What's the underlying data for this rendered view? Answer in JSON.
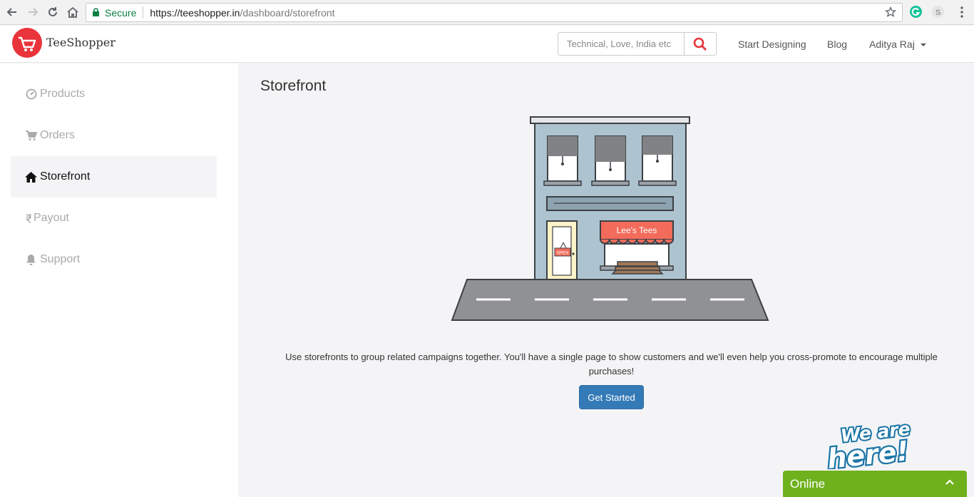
{
  "browser": {
    "secure_label": "Secure",
    "url_host": "https://teeshopper.in",
    "url_path": "/dashboard/storefront",
    "icons": [
      "back-icon",
      "forward-icon",
      "reload-icon",
      "home-icon",
      "lock-icon",
      "star-icon",
      "grammarly-icon",
      "skype-icon",
      "menu-icon"
    ]
  },
  "header": {
    "brand": "TeeShopper",
    "search_placeholder": "Technical, Love, India etc",
    "nav": {
      "start_designing": "Start Designing",
      "blog": "Blog",
      "user": "Aditya Raj"
    }
  },
  "sidebar": {
    "items": [
      {
        "label": "Products",
        "icon": "dashboard-icon",
        "active": false
      },
      {
        "label": "Orders",
        "icon": "cart-icon",
        "active": false
      },
      {
        "label": "Storefront",
        "icon": "home-icon",
        "active": true
      },
      {
        "label": "Payout",
        "icon": "rupee-icon",
        "active": false
      },
      {
        "label": "Support",
        "icon": "bell-icon",
        "active": false
      }
    ]
  },
  "main": {
    "title": "Storefront",
    "illustration": {
      "store_sign": "Lee's Tees",
      "door_sign": "OPEN"
    },
    "description": "Use storefronts to group related campaigns together. You'll have a single page to show customers and we'll even help you cross-promote to encourage multiple purchases!",
    "cta_label": "Get Started"
  },
  "chat": {
    "badge_line1": "We are",
    "badge_line2": "here!",
    "status": "Online"
  },
  "colors": {
    "brand_red": "#e8343a",
    "primary_button": "#337ab7",
    "online_green": "#6fb11d",
    "store_sign": "#f26b5b"
  }
}
